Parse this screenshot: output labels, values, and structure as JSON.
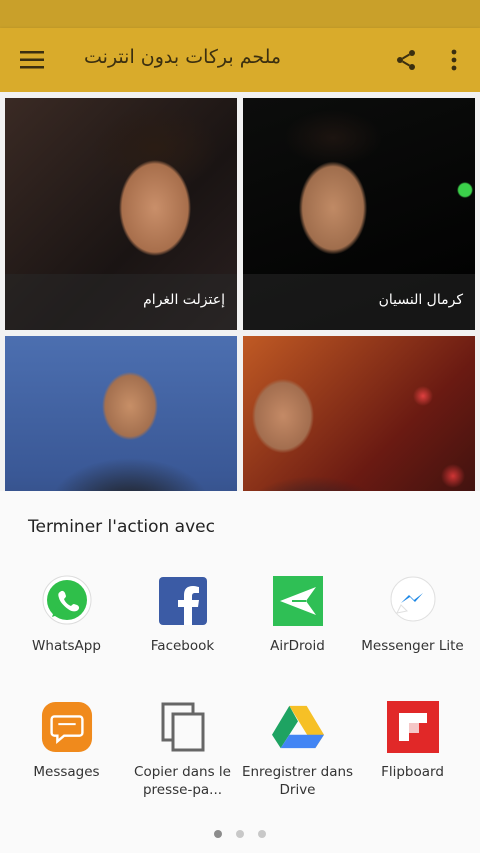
{
  "app_bar": {
    "title": "ملحم بركات بدون انترنت",
    "menu_icon": "hamburger-menu-icon",
    "share_icon": "share-icon",
    "more_icon": "more-vertical-icon",
    "color": "#d9ab2b"
  },
  "songs": [
    {
      "title": "إعتزلت الغرام"
    },
    {
      "title": "كرمال النسيان"
    },
    {
      "title": ""
    },
    {
      "title": ""
    }
  ],
  "share_sheet": {
    "title": "Terminer l'action avec",
    "apps": [
      {
        "label": "WhatsApp",
        "icon": "whatsapp-icon"
      },
      {
        "label": "Facebook",
        "icon": "facebook-icon"
      },
      {
        "label": "AirDroid",
        "icon": "airdroid-icon"
      },
      {
        "label": "Messenger Lite",
        "icon": "messenger-lite-icon"
      },
      {
        "label": "Messages",
        "icon": "messages-icon"
      },
      {
        "label": "Copier dans le presse-pa...",
        "icon": "copy-icon"
      },
      {
        "label": "Enregistrer dans Drive",
        "icon": "google-drive-icon"
      },
      {
        "label": "Flipboard",
        "icon": "flipboard-icon"
      }
    ],
    "page_indicator": {
      "count": 3,
      "active": 1
    }
  }
}
